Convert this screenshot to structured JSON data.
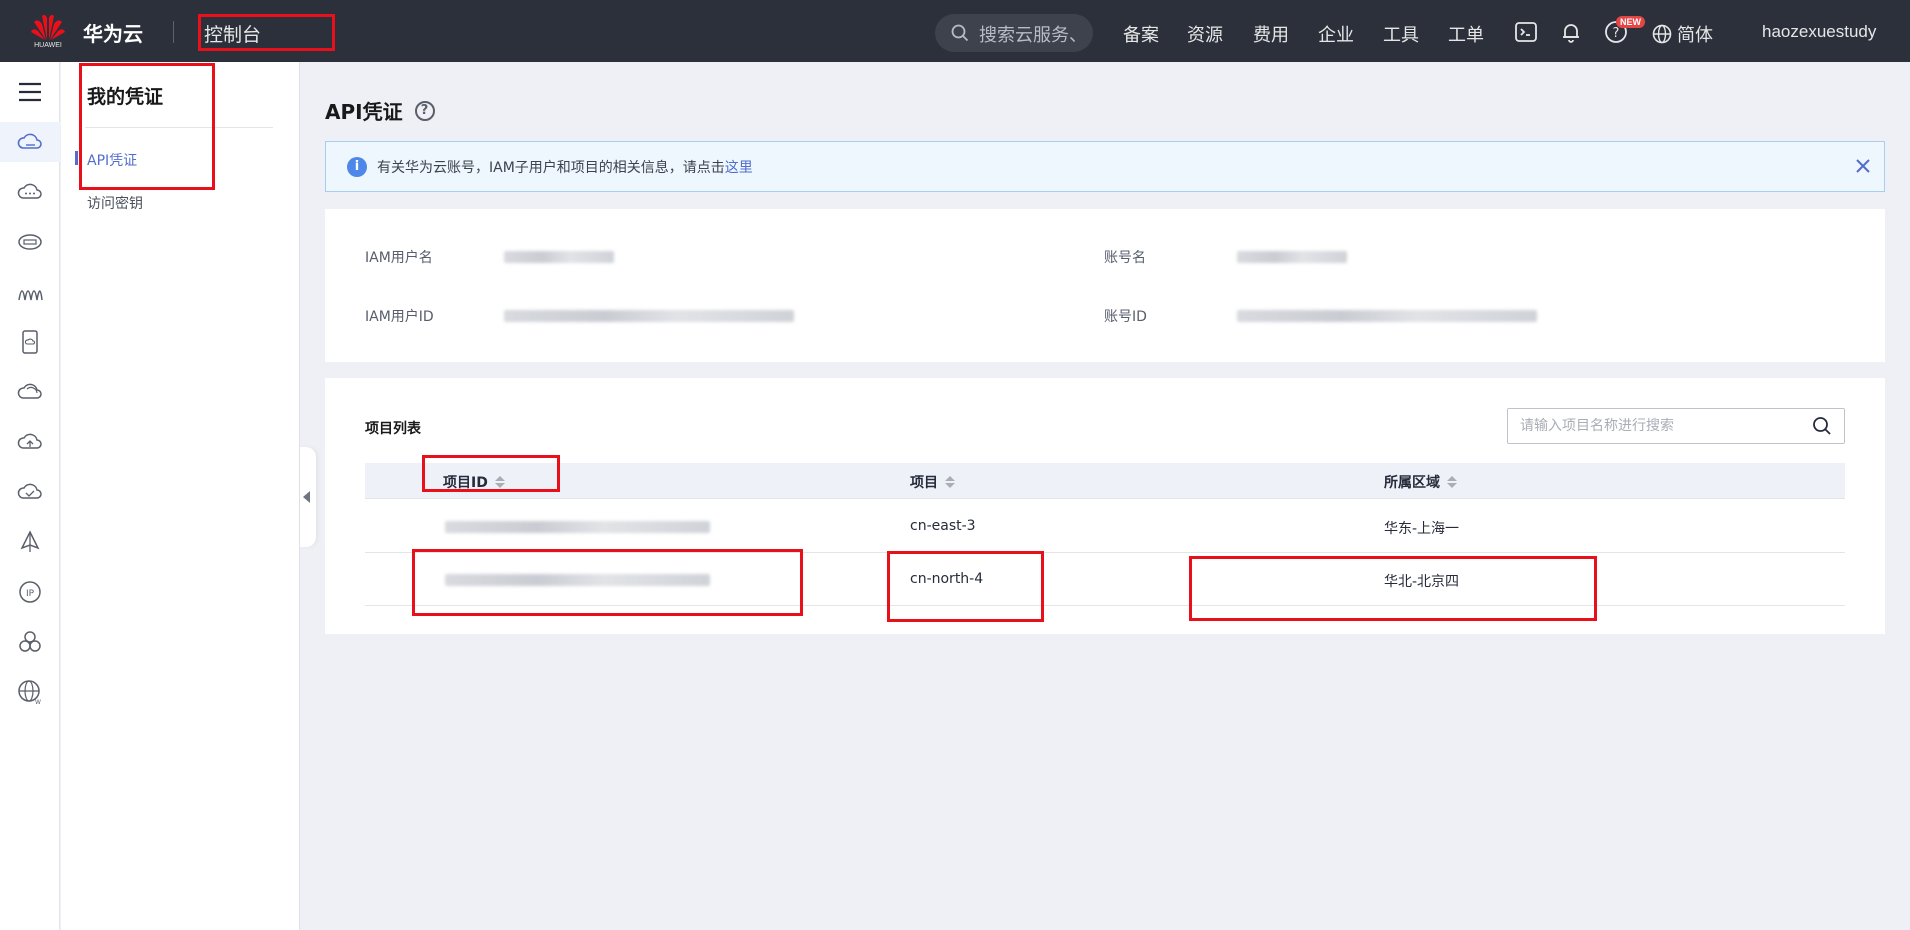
{
  "topbar": {
    "logo_text": "HUAWEI",
    "brand": "华为云",
    "console_title": "控制台",
    "search_placeholder": "搜索云服务、",
    "nav": [
      "备案",
      "资源",
      "费用",
      "企业",
      "工具",
      "工单"
    ],
    "new_badge": "NEW",
    "language": "简体",
    "username": "haozexuestudy"
  },
  "rail_icons": [
    "cloud-drive-icon",
    "cloud-chat-icon",
    "dns-icon",
    "waveform-icon",
    "mobile-cloud-icon",
    "cloud-refresh-icon",
    "cloud-upload-icon",
    "cloud-check-icon",
    "sail-icon",
    "ip-icon",
    "cluster-icon",
    "globe-web-icon"
  ],
  "subnav": {
    "title": "我的凭证",
    "items": [
      {
        "label": "API凭证",
        "active": true
      },
      {
        "label": "访问密钥",
        "active": false
      }
    ]
  },
  "main": {
    "title": "API凭证",
    "info": {
      "text": "有关华为云账号，IAM子用户和项目的相关信息，请点击",
      "link": "这里"
    },
    "credentials": {
      "iam_user_name_label": "IAM用户名",
      "account_name_label": "账号名",
      "iam_user_id_label": "IAM用户ID",
      "account_id_label": "账号ID"
    },
    "projects": {
      "title": "项目列表",
      "search_placeholder": "请输入项目名称进行搜索",
      "columns": [
        "项目ID",
        "项目",
        "所属区域"
      ],
      "rows": [
        {
          "project": "cn-east-3",
          "region": "华东-上海一"
        },
        {
          "project": "cn-north-4",
          "region": "华北-北京四"
        }
      ]
    }
  },
  "colors": {
    "topbar": "#2b303b",
    "accent": "#526ecc",
    "annotation": "#e8101a"
  }
}
